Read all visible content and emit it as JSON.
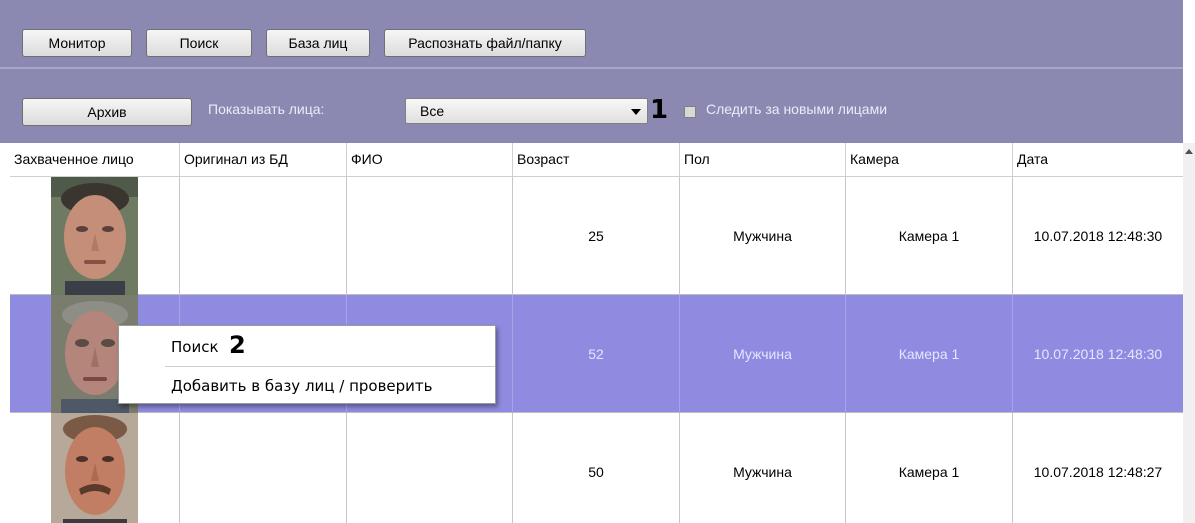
{
  "toolbar": {
    "monitor_label": "Монитор",
    "search_label": "Поиск",
    "face_db_label": "База лиц",
    "recognize_label": "Распознать файл/папку"
  },
  "filter": {
    "archive_label": "Архив",
    "show_faces_label": "Показывать лица:",
    "show_faces_value": "Все",
    "follow_new_label": "Следить за новыми лицами",
    "follow_new_checked": false
  },
  "markers": {
    "m1": "1",
    "m2": "2"
  },
  "table": {
    "columns": [
      "Захваченное лицо",
      "Оригинал из БД",
      "ФИО",
      "Возраст",
      "Пол",
      "Камера",
      "Дата"
    ],
    "rows": [
      {
        "age": "25",
        "gender": "Мужчина",
        "camera": "Камера 1",
        "date": "10.07.2018 12:48:30",
        "selected": false
      },
      {
        "age": "52",
        "gender": "Мужчина",
        "camera": "Камера 1",
        "date": "10.07.2018 12:48:30",
        "selected": true
      },
      {
        "age": "50",
        "gender": "Мужчина",
        "camera": "Камера 1",
        "date": "10.07.2018 12:48:27",
        "selected": false
      }
    ]
  },
  "context_menu": {
    "search_label": "Поиск",
    "add_label": "Добавить в базу лиц / проверить"
  },
  "colors": {
    "panel_bg": "#8b89b1",
    "selected_row": "#8e8be0"
  }
}
